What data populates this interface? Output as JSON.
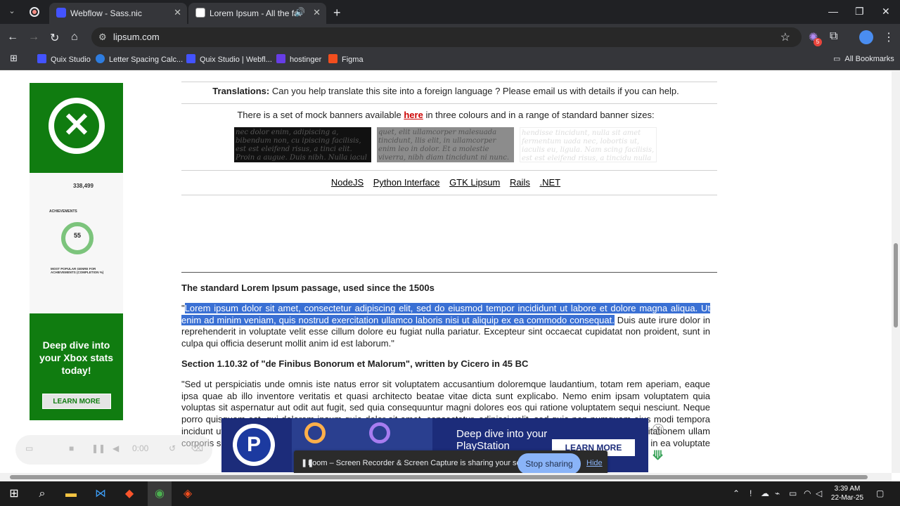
{
  "tabs": [
    {
      "title": "Webflow - Sass.nic",
      "active": false
    },
    {
      "title": "Lorem Ipsum - All the facts",
      "active": true
    }
  ],
  "address": {
    "url": "lipsum.com"
  },
  "extension_badge": "5",
  "bookmarks": [
    {
      "label": "Quix Studio",
      "icon": "webflow-icon"
    },
    {
      "label": "Letter Spacing Calc...",
      "icon": "s-icon"
    },
    {
      "label": "Quix Studio | Webfl...",
      "icon": "webflow-icon"
    },
    {
      "label": "hostinger",
      "icon": "hostinger-icon"
    },
    {
      "label": "Figma",
      "icon": "figma-icon"
    }
  ],
  "all_bookmarks": "All Bookmarks",
  "page": {
    "translations_label": "Translations:",
    "translations_text": " Can you help translate this site into a foreign language ? Please email us with details if you can help.",
    "banners_pre": "There is a set of mock banners available ",
    "banners_link": "here",
    "banners_post": " in three colours and in a range of standard banner sizes:",
    "banner_sample_1": "nec dolor enim, adipiscing a, bibendum non, cu ipiscing facilisis, est est eleifend risus, a tinci elit. Proin a augue. Duis nibh. Nulla iacul . Quisque pharetra consectetuer ipsum Sed",
    "banner_sample_2": "quet, elit ullamcorper malesuada tincidunt, llis elit, in ullamcorper enim leo in dolor. Et a molestie viverra, nibh diam tincidunt ni nunc. Donec enim. Proin iaculis pulvinar",
    "banner_sample_3": "hendisse tincidunt, nulla sit amet fermentum uada nec, lobortis ut, iaculis eu, ligula. Nam scing facilisis, est est eleifend risus, a tincidu nulla luctus dignissim. Proin leo massa commo",
    "links": [
      "NodeJS",
      "Python Interface",
      "GTK Lipsum",
      "Rails",
      ".NET"
    ],
    "section1_title": "The standard Lorem Ipsum passage, used since the 1500s",
    "section1_quote_open": "\"",
    "section1_selected": "Lorem ipsum dolor sit amet, consectetur adipiscing elit, sed do eiusmod tempor incididunt ut labore et dolore magna aliqua. Ut enim ad minim veniam, quis nostrud exercitation ullamco laboris nisi ut aliquip ex ea commodo consequat.",
    "section1_rest": " Duis aute irure dolor in reprehenderit in voluptate velit esse cillum dolore eu fugiat nulla pariatur. Excepteur sint occaecat cupidatat non proident, sunt in culpa qui officia deserunt mollit anim id est laborum.\"",
    "section2_title": "Section 1.10.32 of \"de Finibus Bonorum et Malorum\", written by Cicero in 45 BC",
    "section2_text": "\"Sed ut perspiciatis unde omnis iste natus error sit voluptatem accusantium doloremque laudantium, totam rem aperiam, eaque ipsa quae ab illo inventore veritatis et quasi architecto beatae vitae dicta sunt explicabo. Nemo enim ipsam voluptatem quia voluptas sit aspernatur aut odit aut fugit, sed quia consequuntur magni dolores eos qui ratione voluptatem sequi nesciunt. Neque porro quisquam est, qui dolorem ipsum quia dolor sit amet, consectetur, adipisci velit, sed quia non numquam eius modi tempora incidunt ut labore et dolore magnam aliquam quaerat voluptatem. Ut enim ad minima veniam, quis nostrum exercitationem ullam corporis suscipit laboriosam, nisi ut aliquid ex ea commodi consequatur? Quis autem vel eum iure reprehenderit qui in ea voluptate velit esse quam nihil"
  },
  "left_ad": {
    "stat": "338,499",
    "achievements": "ACHIEVEMENTS",
    "ring_value": "55",
    "genre_title": "MOST POPULAR GENRE FOR ACHIEVEMENTS (COMPLETION %)",
    "headline": "Deep dive into your Xbox stats today!",
    "cta": "LEARN MORE"
  },
  "bottom_ad": {
    "headline": "Deep dive into your PlayStation",
    "cta": "LEARN MORE"
  },
  "loom": {
    "message": "Loom – Screen Recorder & Screen Capture is sharing your screen.",
    "stop": "Stop sharing",
    "hide": "Hide",
    "timer": "0:00"
  },
  "clock": {
    "time": "3:39 AM",
    "date": "22-Mar-25"
  }
}
